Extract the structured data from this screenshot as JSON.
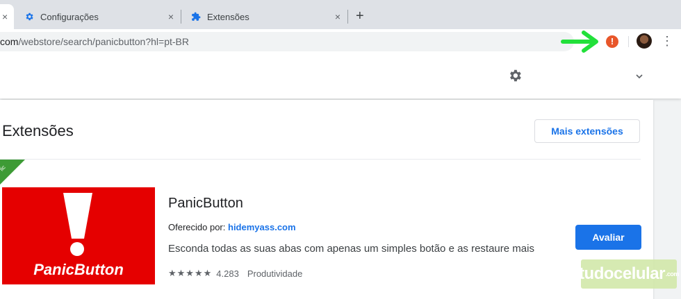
{
  "browser": {
    "tabs": [
      {
        "title": "Configurações",
        "close": "×"
      },
      {
        "title": "Extensões",
        "close": "×"
      }
    ],
    "active_tab_close": "×",
    "new_tab": "+",
    "url_host": "com",
    "url_path": "/webstore/search/panicbutton?hl=pt-BR",
    "toolbar": {
      "alert_badge": "!",
      "menu": "⋮"
    },
    "colors": {
      "arrow": "#22e03a",
      "alert": "#e8562a"
    }
  },
  "page": {
    "section_title": "Extensões",
    "more_button": "Mais extensões",
    "ribbon": "lic",
    "extension": {
      "logo_text": "PanicButton",
      "logo_mark": "!",
      "name": "PanicButton",
      "offered_label": "Oferecido por: ",
      "offered_by": "hidemyass.com",
      "description": "Esconda todas as suas abas com apenas um simples botão e as restaure mais",
      "stars": "★★★★★",
      "rating_count": "4.283",
      "category": "Produtividade",
      "rate_button": "Avaliar"
    }
  },
  "watermark": {
    "text": "tudocelular",
    "sup": ".com"
  }
}
